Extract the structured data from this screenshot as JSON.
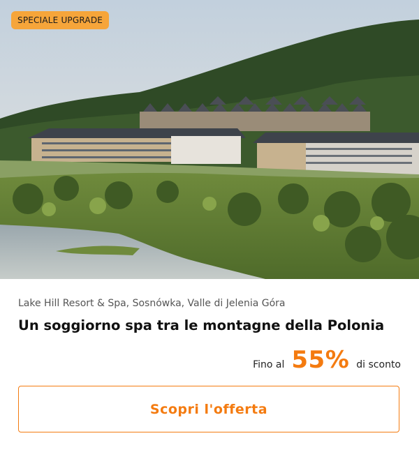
{
  "badge": {
    "label": "SPECIALE UPGRADE"
  },
  "offer": {
    "location": "Lake Hill Resort & Spa, Sosnówka, Valle di Jelenia Góra",
    "title": "Un soggiorno spa tra le montagne della Polonia",
    "discount_prefix": "Fino al",
    "discount_value": "55%",
    "discount_suffix": "di sconto",
    "cta_label": "Scopri l'offerta"
  },
  "colors": {
    "accent": "#f47b10",
    "badge_bg": "#f6a53a"
  }
}
